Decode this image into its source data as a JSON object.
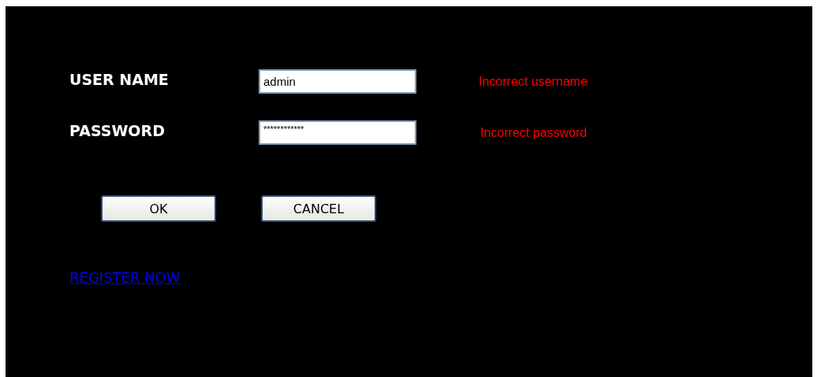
{
  "fields": [
    {
      "label": "USER NAME",
      "kind": "text",
      "value": "admin",
      "error": "Incorrect username"
    },
    {
      "label": "PASSWORD",
      "kind": "password",
      "value": "************",
      "error": "Incorrect password"
    }
  ],
  "buttons": [
    "OK",
    "CANCEL"
  ],
  "link": "REGISTER NOW"
}
